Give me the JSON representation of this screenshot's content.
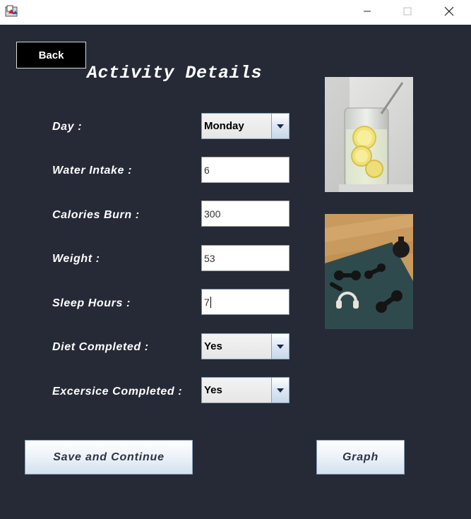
{
  "window": {
    "icons": {
      "app": "java-app-icon",
      "minimize": "minimize-icon",
      "maximize": "maximize-icon",
      "close": "close-icon"
    }
  },
  "header": {
    "back_label": "Back",
    "title": "Activity Details"
  },
  "form": {
    "day": {
      "label": "Day :",
      "value": "Monday"
    },
    "water": {
      "label": "Water Intake :",
      "value": "6"
    },
    "calories": {
      "label": "Calories Burn :",
      "value": "300"
    },
    "weight": {
      "label": "Weight :",
      "value": "53"
    },
    "sleep": {
      "label": "Sleep Hours :",
      "value": "7"
    },
    "diet": {
      "label": "Diet Completed :",
      "value": "Yes"
    },
    "exercise": {
      "label": "Excersice Completed :",
      "value": "Yes"
    }
  },
  "images": [
    {
      "name": "lemon-water-photo"
    },
    {
      "name": "fitness-gear-photo"
    }
  ],
  "actions": {
    "save_label": "Save and Continue",
    "graph_label": "Graph"
  },
  "colors": {
    "panel_bg": "#252a36",
    "back_bg": "#000000",
    "text": "#ffffff",
    "button_text": "#2c3344"
  }
}
